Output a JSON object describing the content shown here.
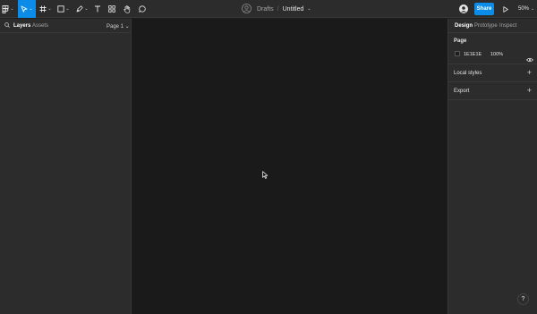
{
  "toolbar": {
    "breadcrumb_folder": "Drafts",
    "breadcrumb_separator": "/",
    "document_name": "Untitled",
    "share_label": "Share",
    "zoom_level": "50%",
    "caret": "⌄",
    "accent_color": "#0c8ce9",
    "icons": [
      "figma-menu-icon",
      "move-tool-icon",
      "frame-tool-icon",
      "shape-tool-icon",
      "pen-tool-icon",
      "text-tool-icon",
      "components-icon",
      "hand-tool-icon",
      "comment-icon",
      "avatar-icon",
      "play-icon"
    ]
  },
  "left_panel": {
    "tabs": [
      "Layers",
      "Assets"
    ],
    "page_selector": "Page 1 ⌄"
  },
  "right_panel": {
    "tabs": [
      "Design",
      "Prototype",
      "Inspect"
    ],
    "page_section": {
      "title": "Page",
      "background_hex": "1E1E1E",
      "opacity": "100%",
      "background_color": "#1e1e1e"
    },
    "local_styles": "Local styles",
    "export": "Export",
    "add_symbol": "+"
  },
  "help_label": "?"
}
